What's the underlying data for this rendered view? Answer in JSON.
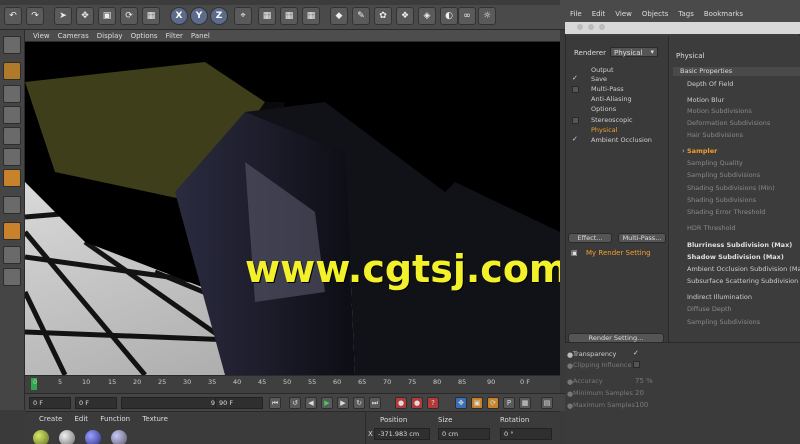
{
  "viewport_menu": [
    "View",
    "Cameras",
    "Display",
    "Options",
    "Filter",
    "Panel"
  ],
  "watermark": "www.cgtsj.com",
  "timeline": {
    "ticks": [
      "0",
      "5",
      "10",
      "15",
      "20",
      "25",
      "30",
      "35",
      "40",
      "45",
      "50",
      "55",
      "60",
      "65",
      "70",
      "75",
      "80",
      "85",
      "90"
    ],
    "frame_end_label": "0 F"
  },
  "playbar": {
    "start": "0 F",
    "min": "0 F",
    "max": "90 F",
    "end": "90 F"
  },
  "material_menu": [
    "Create",
    "Edit",
    "Function",
    "Texture"
  ],
  "coordinates": {
    "headers": [
      "Position",
      "Size",
      "Rotation"
    ],
    "x_label": "X",
    "x_pos": "-371.983 cm",
    "x_size": "0 cm",
    "x_rot": "0 °"
  },
  "right_menu": [
    "File",
    "Edit",
    "View",
    "Objects",
    "Tags",
    "Bookmarks"
  ],
  "render_settings": {
    "renderer_label": "Renderer",
    "renderer_value": "Physical",
    "items": [
      {
        "label": "Output",
        "check": ""
      },
      {
        "label": "Save",
        "check": "✓"
      },
      {
        "label": "Multi-Pass",
        "check": "box"
      },
      {
        "label": "Anti-Aliasing",
        "check": ""
      },
      {
        "label": "Options",
        "check": ""
      },
      {
        "label": "Stereoscopic",
        "check": "box"
      },
      {
        "label": "Physical",
        "check": ""
      },
      {
        "label": "Ambient Occlusion",
        "check": "✓"
      }
    ],
    "effect_button": "Effect...",
    "multipass_button": "Multi-Pass...",
    "my_setting": "My Render Setting",
    "render_setting_button": "Render Setting...",
    "panel_title": "Physical",
    "section": "Basic Properties",
    "props": [
      {
        "label": "Depth Of Field",
        "style": "normal"
      },
      {
        "label": "Motion Blur",
        "style": "normal"
      },
      {
        "label": "Motion Subdivisions",
        "style": "dim"
      },
      {
        "label": "Deformation Subdivisions",
        "style": "dim"
      },
      {
        "label": "Hair Subdivisions",
        "style": "dim"
      },
      {
        "label": "Sampler",
        "style": "orange"
      },
      {
        "label": "Sampling Quality",
        "style": "dim"
      },
      {
        "label": "Sampling Subdivisions",
        "style": "dim"
      },
      {
        "label": "Shading Subdivisions (Min)",
        "style": "dim"
      },
      {
        "label": "Shading Subdivisions",
        "style": "dim"
      },
      {
        "label": "Shading Error Threshold",
        "style": "dim"
      },
      {
        "label": "HDR Threshold",
        "style": "dim"
      },
      {
        "label": "Blurriness Subdivision (Max)",
        "style": "bold"
      },
      {
        "label": "Shadow Subdivision (Max)",
        "style": "bold"
      },
      {
        "label": "Ambient Occlusion Subdivision (Ma",
        "style": "normal"
      },
      {
        "label": "Subsurface Scattering Subdivision (M",
        "style": "normal"
      },
      {
        "label": "Indirect Illumination",
        "style": "normal"
      },
      {
        "label": "Diffuse Depth",
        "style": "dim"
      },
      {
        "label": "Sampling Subdivisions",
        "style": "dim"
      }
    ]
  },
  "attributes": {
    "transparency_label": "Transparency",
    "clipping_label": "Clipping Influence",
    "accuracy_label": "Accuracy",
    "accuracy_value": "75 %",
    "min_samples_label": "Minimum Samples",
    "min_samples_value": "20",
    "max_samples_label": "Maximum Samples",
    "max_samples_value": "100"
  }
}
